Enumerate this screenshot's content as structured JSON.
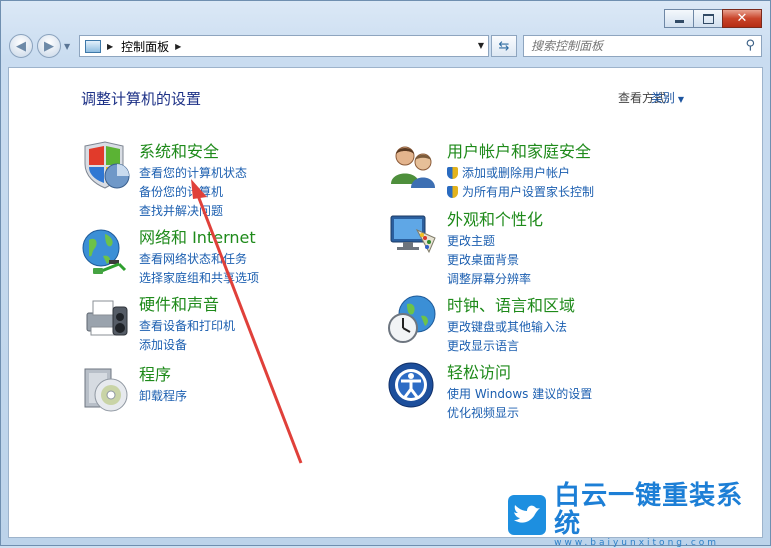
{
  "window": {
    "min_label": "",
    "close_glyph": "✕"
  },
  "address": {
    "crumb": "控制面板",
    "search_placeholder": "搜索控制面板"
  },
  "header": {
    "title": "调整计算机的设置",
    "view_by_label": "查看方式:",
    "view_by_value": "类别"
  },
  "categories": [
    {
      "title": "系统和安全",
      "icon": "system-security-icon",
      "links": [
        "查看您的计算机状态",
        "备份您的计算机",
        "查找并解决问题"
      ]
    },
    {
      "title": "网络和 Internet",
      "icon": "network-globe-icon",
      "links": [
        "查看网络状态和任务",
        "选择家庭组和共享选项"
      ]
    },
    {
      "title": "硬件和声音",
      "icon": "printer-icon",
      "links": [
        "查看设备和打印机",
        "添加设备"
      ]
    },
    {
      "title": "程序",
      "icon": "programs-disc-icon",
      "links": [
        "卸载程序"
      ]
    },
    {
      "title": "用户帐户和家庭安全",
      "icon": "users-icon",
      "links": [
        "添加或删除用户帐户",
        "为所有用户设置家长控制"
      ]
    },
    {
      "title": "外观和个性化",
      "icon": "monitor-palette-icon",
      "links": [
        "更改主题",
        "更改桌面背景",
        "调整屏幕分辨率"
      ]
    },
    {
      "title": "时钟、语言和区域",
      "icon": "clock-globe-icon",
      "links": [
        "更改键盘或其他输入法",
        "更改显示语言"
      ]
    },
    {
      "title": "轻松访问",
      "icon": "ease-of-access-icon",
      "links": [
        "使用 Windows 建议的设置",
        "优化视频显示"
      ]
    }
  ],
  "watermark": {
    "brand": "白云一键重装系统",
    "url": "www.baiyunxitong.com"
  },
  "colors": {
    "category_title": "#1e8a1a",
    "link": "#1c5fb0",
    "heading": "#1e3287",
    "annotation_arrow": "#e0403a"
  }
}
